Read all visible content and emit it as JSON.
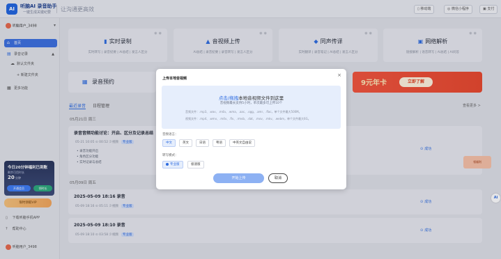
{
  "app": {
    "name": "听脑AI 录音助手",
    "tagline": "一键生成关键纪要",
    "slogan": "让沟通更高效",
    "logo_text": "AI"
  },
  "header": {
    "buttons": [
      {
        "label": "移动端",
        "icon": "mobile-icon"
      },
      {
        "label": "微信小程序",
        "icon": "wechat-icon"
      },
      {
        "label": "支付",
        "icon": "wallet-icon"
      }
    ]
  },
  "sidebar": {
    "user": "听脑用户_3498",
    "items": [
      {
        "label": "首页",
        "icon": "home-icon",
        "active": true
      },
      {
        "label": "录音记录",
        "icon": "folder-icon",
        "active": false
      },
      {
        "label": "默认文件夹",
        "icon": "cloud-folder-icon",
        "active": false
      },
      {
        "label": "+ 新建文件夹",
        "icon": "plus-icon",
        "active": false
      },
      {
        "label": "更多功能",
        "icon": "grid-icon",
        "active": false
      }
    ],
    "promo": {
      "title": "今日20分钟福利已到账",
      "sub": "剩余可用时长",
      "minutes": "20",
      "unit": "分钟",
      "btn_vip": "开通会员",
      "btn_free": "领时长"
    },
    "vip_bar": "限时领取VIP",
    "links": [
      {
        "label": "下载听脑手机APP",
        "icon": "phone-icon"
      },
      {
        "label": "帮助中心",
        "icon": "help-icon"
      }
    ],
    "footer_user": "听脑用户_3498"
  },
  "features": [
    {
      "title": "实时录制",
      "desc": "实时转写 | 录音纪要 | AI总结 | 发言人区分",
      "icon": "record-icon"
    },
    {
      "title": "音视频上传",
      "desc": "AI总结 | 录音纪要 | 录音转写 | 发言人区分",
      "icon": "upload-icon"
    },
    {
      "title": "同声传译",
      "desc": "实时翻译 | 录音笔记 | AI总结 | 发言人区分",
      "icon": "translate-icon"
    },
    {
      "title": "网络解析",
      "desc": "链接解析 | 语音转写 | AI总结 | AI问答",
      "icon": "link-icon"
    }
  ],
  "record_card": {
    "title": "录音预约",
    "icon": "calendar-icon"
  },
  "banner": {
    "text": "9元年卡",
    "button": "立即了解"
  },
  "tabs": [
    {
      "label": "最近录音",
      "active": true
    },
    {
      "label": "日程管理",
      "active": false
    }
  ],
  "view_more": "查看更多 >",
  "groups": [
    {
      "date": "05月21日 周三",
      "items": [
        {
          "title": "录音音频功能讨论：开启、区分及记录总结",
          "meta": "05-21 10:05 ⊙ 00:52 少视频",
          "tag": "专业版",
          "bullets": [
            "录音功能开启",
            "角色区分功能",
            "实时记录与总结"
          ],
          "status": "成功"
        }
      ]
    },
    {
      "date": "05月09日 周五",
      "items": [
        {
          "title": "2025-05-09 18:16 录音",
          "meta": "05-09 18:16 ⊙ 05:11 少视频",
          "tag": "专业版",
          "status": "成功"
        },
        {
          "title": "2025-05-09 18:10 录音",
          "meta": "05-09 18:10 ⊙ 03:58 少视频",
          "tag": "专业版",
          "status": "成功"
        }
      ]
    }
  ],
  "side_widgets": {
    "ai_button": "Ai",
    "gift": "领福利"
  },
  "modal": {
    "title": "上传本地音视频",
    "close": "×",
    "drop_link": "点击/拖拽",
    "drop_text": "本地音视频文件到这里",
    "drop_sub": "音视频最长支持5小时，单次最多可上传10个",
    "audio_formats": "音频文件：.mp3、.wav、.m4a、.wma、.aac、.ogg、.amr、.flac，单个文件最大500M。",
    "video_formats": "视频文件：.mp4、.wmv、.m4v、.flv、.rmvb、.dat、.mov、.mkv、.webm，单个文件最大6G。",
    "language_label": "音频语言：",
    "languages": [
      {
        "label": "中文",
        "selected": true
      },
      {
        "label": "英文",
        "selected": false
      },
      {
        "label": "日语",
        "selected": false
      },
      {
        "label": "粤语",
        "selected": false
      },
      {
        "label": "中英文自由说",
        "selected": false
      }
    ],
    "mode_label": "转写模式：",
    "modes": [
      {
        "label": "专业版",
        "selected": true
      },
      {
        "label": "极速版",
        "selected": false
      }
    ],
    "start_button": "开始上传",
    "cancel_button": "取消"
  }
}
